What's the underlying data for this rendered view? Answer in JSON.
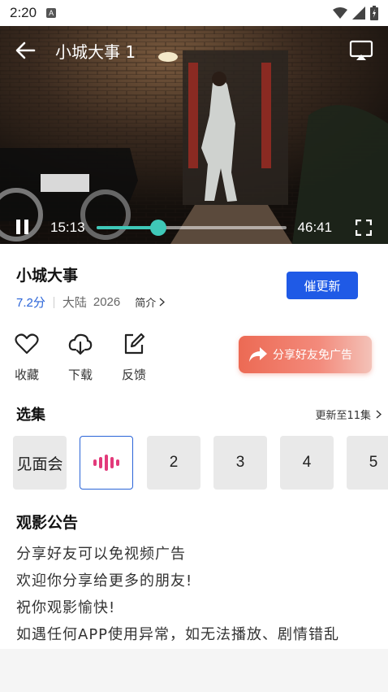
{
  "status_bar": {
    "time": "2:20",
    "badge": "A"
  },
  "player": {
    "title": "小城大事 1",
    "current_time": "15:13",
    "duration": "46:41",
    "progress": 0.326,
    "accent_color": "#3fc8b8"
  },
  "show": {
    "name": "小城大事",
    "score": "7.2分",
    "region": "大陆",
    "year": "2026",
    "intro_label": "简介",
    "urge_button": "催更新"
  },
  "actions": [
    {
      "label": "收藏",
      "icon": "heart-icon"
    },
    {
      "label": "下载",
      "icon": "cloud-download-icon"
    },
    {
      "label": "反馈",
      "icon": "edit-feedback-icon"
    }
  ],
  "share_button": {
    "label": "分享好友免广告",
    "icon": "share-arrow-icon"
  },
  "episodes": {
    "title": "选集",
    "more_label": "更新至11集",
    "items": [
      "见面会",
      "",
      "2",
      "3",
      "4",
      "5"
    ],
    "active_index": 1,
    "active_icon": "playing-bars-icon"
  },
  "notice": {
    "title": "观影公告",
    "lines": [
      "分享好友可以免视频广告",
      "欢迎你分享给更多的朋友!",
      "祝你观影愉快!",
      "如遇任何APP使用异常，如无法播放、剧情错乱"
    ]
  }
}
